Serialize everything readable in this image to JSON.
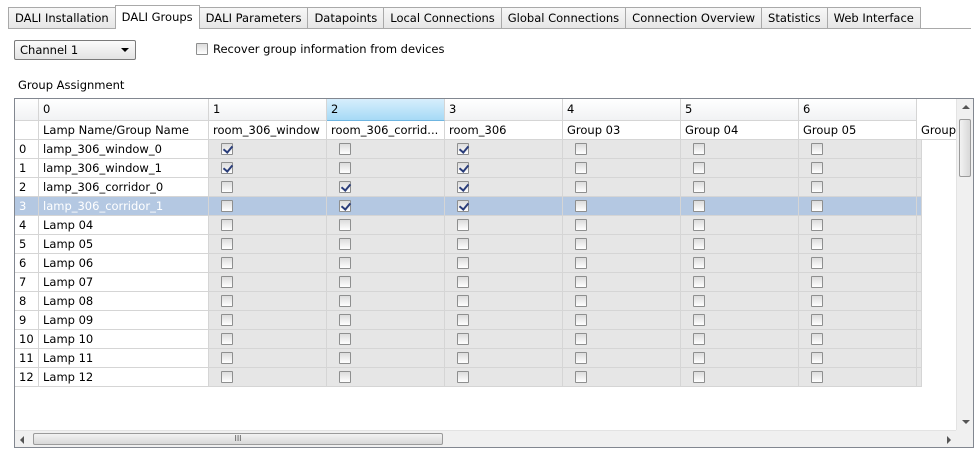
{
  "tabs": [
    {
      "label": "DALI Installation",
      "active": false
    },
    {
      "label": "DALI Groups",
      "active": true
    },
    {
      "label": "DALI Parameters",
      "active": false
    },
    {
      "label": "Datapoints",
      "active": false
    },
    {
      "label": "Local Connections",
      "active": false
    },
    {
      "label": "Global Connections",
      "active": false
    },
    {
      "label": "Connection Overview",
      "active": false
    },
    {
      "label": "Statistics",
      "active": false
    },
    {
      "label": "Web Interface",
      "active": false
    }
  ],
  "channel_select": {
    "value": "Channel 1"
  },
  "recover_checkbox": {
    "label": "Recover group information from devices",
    "checked": false
  },
  "group_assignment_label": "Group Assignment",
  "grid": {
    "column_numbers": [
      "",
      "0",
      "1",
      "2",
      "3",
      "4",
      "5",
      "6"
    ],
    "selected_column": 2,
    "header_row": [
      "Lamp Name/Group Name",
      "room_306_window",
      "room_306_corrid...",
      "room_306",
      "Group 03",
      "Group 04",
      "Group 05",
      "Group"
    ],
    "rows": [
      {
        "index": "0",
        "name": "lamp_306_window_0",
        "checks": [
          true,
          false,
          true,
          false,
          false,
          false,
          false
        ]
      },
      {
        "index": "1",
        "name": "lamp_306_window_1",
        "checks": [
          true,
          false,
          true,
          false,
          false,
          false,
          false
        ]
      },
      {
        "index": "2",
        "name": "lamp_306_corridor_0",
        "checks": [
          false,
          true,
          true,
          false,
          false,
          false,
          false
        ]
      },
      {
        "index": "3",
        "name": "lamp_306_corridor_1",
        "checks": [
          false,
          true,
          true,
          false,
          false,
          false,
          false
        ],
        "selected": true
      },
      {
        "index": "4",
        "name": "Lamp 04",
        "checks": [
          false,
          false,
          false,
          false,
          false,
          false,
          false
        ]
      },
      {
        "index": "5",
        "name": "Lamp 05",
        "checks": [
          false,
          false,
          false,
          false,
          false,
          false,
          false
        ]
      },
      {
        "index": "6",
        "name": "Lamp 06",
        "checks": [
          false,
          false,
          false,
          false,
          false,
          false,
          false
        ]
      },
      {
        "index": "7",
        "name": "Lamp 07",
        "checks": [
          false,
          false,
          false,
          false,
          false,
          false,
          false
        ]
      },
      {
        "index": "8",
        "name": "Lamp 08",
        "checks": [
          false,
          false,
          false,
          false,
          false,
          false,
          false
        ]
      },
      {
        "index": "9",
        "name": "Lamp 09",
        "checks": [
          false,
          false,
          false,
          false,
          false,
          false,
          false
        ]
      },
      {
        "index": "10",
        "name": "Lamp 10",
        "checks": [
          false,
          false,
          false,
          false,
          false,
          false,
          false
        ]
      },
      {
        "index": "11",
        "name": "Lamp 11",
        "checks": [
          false,
          false,
          false,
          false,
          false,
          false,
          false
        ]
      },
      {
        "index": "12",
        "name": "Lamp 12",
        "checks": [
          false,
          false,
          false,
          false,
          false,
          false,
          false
        ]
      }
    ],
    "hscroll_grip": "III"
  }
}
